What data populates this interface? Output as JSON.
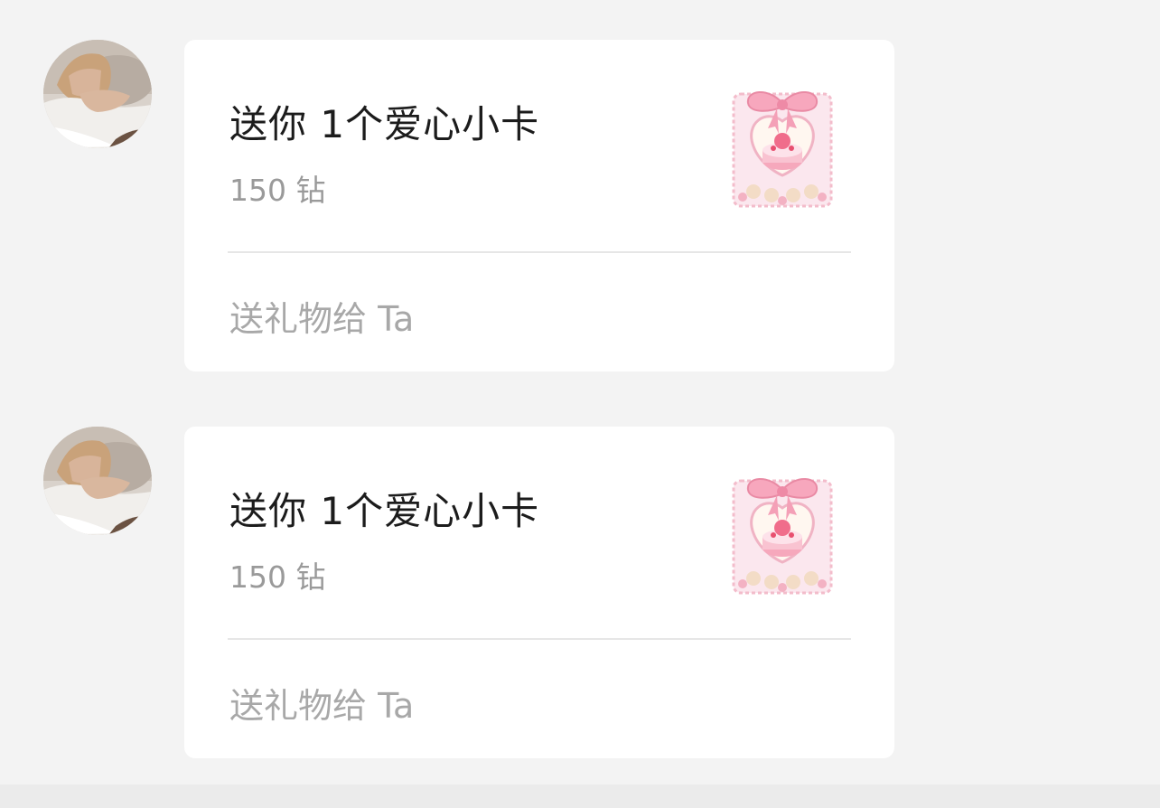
{
  "messages": [
    {
      "gift_title": "送你 1个爱心小卡",
      "gift_price": "150 钻",
      "action_label": "送礼物给 Ta",
      "gift_icon": "bow-cake-gift-card-icon"
    },
    {
      "gift_title": "送你 1个爱心小卡",
      "gift_price": "150 钻",
      "action_label": "送礼物给 Ta",
      "gift_icon": "bow-cake-gift-card-icon"
    }
  ],
  "colors": {
    "background": "#f3f3f3",
    "card": "#ffffff",
    "title_text": "#1c1c1c",
    "secondary_text": "#9a9a9a",
    "gift_pink": "#f2a9bd"
  }
}
